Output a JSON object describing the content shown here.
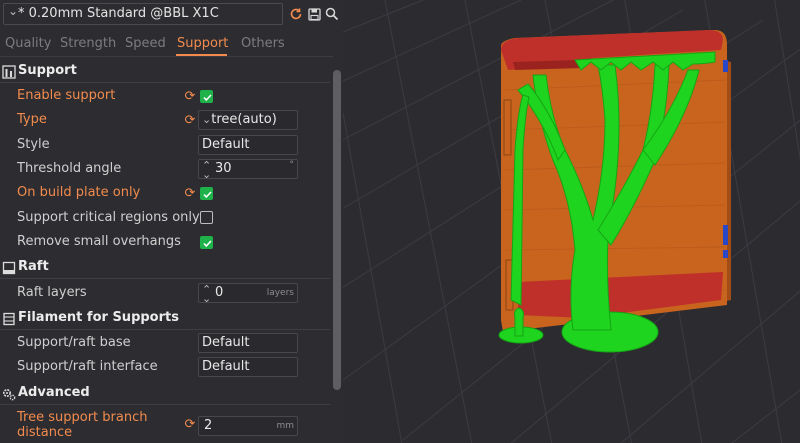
{
  "preset": {
    "name": "* 0.20mm Standard @BBL X1C"
  },
  "tabs": [
    {
      "label": "Quality",
      "active": false
    },
    {
      "label": "Strength",
      "active": false
    },
    {
      "label": "Speed",
      "active": false
    },
    {
      "label": "Support",
      "active": true
    },
    {
      "label": "Others",
      "active": false
    }
  ],
  "sections": {
    "support": {
      "title": "Support",
      "enable_support": {
        "label": "Enable support",
        "checked": true
      },
      "type": {
        "label": "Type",
        "value": "tree(auto)"
      },
      "style": {
        "label": "Style",
        "value": "Default"
      },
      "threshold_angle": {
        "label": "Threshold angle",
        "value": "30",
        "unit": "°"
      },
      "on_build_plate_only": {
        "label": "On build plate only",
        "checked": true
      },
      "support_critical_regions_only": {
        "label": "Support critical regions only",
        "checked": false
      },
      "remove_small_overhangs": {
        "label": "Remove small overhangs",
        "checked": true
      }
    },
    "raft": {
      "title": "Raft",
      "raft_layers": {
        "label": "Raft layers",
        "value": "0",
        "unit": "layers"
      }
    },
    "filament": {
      "title": "Filament for Supports",
      "support_raft_base": {
        "label": "Support/raft base",
        "value": "Default"
      },
      "support_raft_interface": {
        "label": "Support/raft interface",
        "value": "Default"
      }
    },
    "advanced": {
      "title": "Advanced",
      "tree_branch_distance": {
        "label_line1": "Tree support branch",
        "label_line2": "distance",
        "value": "2",
        "unit": "mm"
      }
    }
  },
  "colors": {
    "accent": "#f28b4d",
    "checkbox_on": "#1fb14a",
    "model_orange": "#c8641e",
    "overhang_red": "#c0302a",
    "support_green": "#1fd41f",
    "grid": "#3c3c42"
  },
  "icons": {
    "preset_dropdown": "chevron-down-icon",
    "toolbar": [
      "refresh-icon",
      "save-icon",
      "search-icon"
    ],
    "support_section": "support-section-icon",
    "raft_section": "raft-section-icon",
    "filament_section": "filament-section-icon",
    "advanced_section": "gears-icon",
    "reset": "reset-arrow-icon"
  }
}
